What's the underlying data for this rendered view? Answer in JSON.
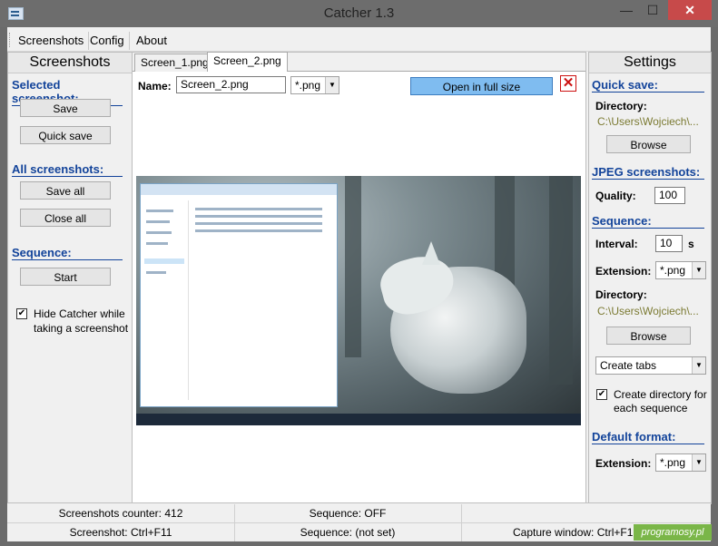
{
  "window": {
    "title": "Catcher 1.3",
    "min_glyph": "—",
    "max_glyph": "☐",
    "close_glyph": "✕",
    "app_icon": "camera-app-icon"
  },
  "menu": {
    "items": [
      "Screenshots",
      "Config",
      "About"
    ]
  },
  "left_panel": {
    "title": "Screenshots",
    "selected_label": "Selected screenshot:",
    "save": "Save",
    "quick_save": "Quick save",
    "all_label": "All screenshots:",
    "save_all": "Save all",
    "close_all": "Close all",
    "sequence_label": "Sequence:",
    "start": "Start",
    "hide_checkbox": {
      "checked": true,
      "line1": "Hide Catcher while",
      "line2": "taking a screenshot"
    }
  },
  "center": {
    "tabs": [
      "Screen_1.png",
      "Screen_2.png"
    ],
    "active_tab": 1,
    "name_label": "Name:",
    "name_value": "Screen_2.png",
    "ext_value": "*.png",
    "open_full": "Open in full size",
    "close_glyph": "✕",
    "check_glyph": "✔"
  },
  "right_panel": {
    "title": "Settings",
    "quick_save_label": "Quick save:",
    "directory_label": "Directory:",
    "directory_path": "C:\\Users\\Wojciech\\...",
    "browse": "Browse",
    "jpeg_label": "JPEG screenshots:",
    "quality_label": "Quality:",
    "quality_value": "100",
    "sequence_label": "Sequence:",
    "interval_label": "Interval:",
    "interval_value": "10",
    "interval_unit": "s",
    "extension_label": "Extension:",
    "extension_value": "*.png",
    "seq_directory_label": "Directory:",
    "seq_directory_path": "C:\\Users\\Wojciech\\...",
    "seq_browse": "Browse",
    "tabs_mode": "Create tabs",
    "create_dir_checkbox": {
      "checked": true,
      "line1": "Create directory for",
      "line2": "each sequence"
    },
    "default_format_label": "Default format:",
    "default_ext_label": "Extension:",
    "default_ext_value": "*.png"
  },
  "status": {
    "counter": "Screenshots counter: 412",
    "sequence": "Sequence: OFF",
    "screenshot_hotkey": "Screenshot: Ctrl+F11",
    "sequence_hotkey": "Sequence: (not set)",
    "capture_window": "Capture window: Ctrl+F1"
  },
  "watermark": "programosy.pl",
  "colors": {
    "section_blue": "#12439a",
    "path_olive": "#7b7a32",
    "open_button": "#7fbcf0",
    "close_red": "#cc1010"
  }
}
